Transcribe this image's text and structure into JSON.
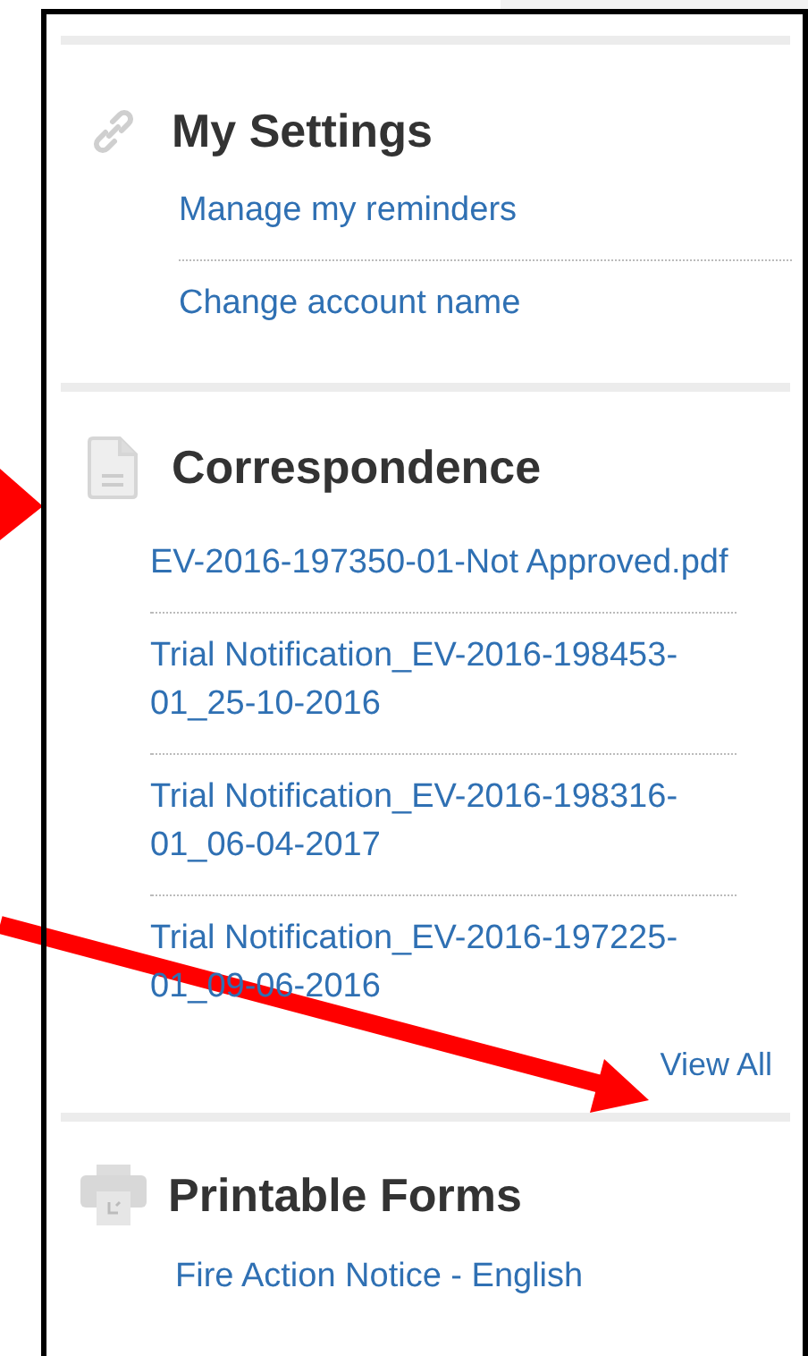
{
  "sections": [
    {
      "kind": "settings",
      "title": "My Settings",
      "links": [
        "Manage my reminders",
        "Change account name"
      ]
    },
    {
      "kind": "document",
      "title": "Correspondence",
      "links": [
        "EV-2016-197350-01-Not Approved.pdf",
        "Trial Notification_EV-2016-198453-01_25-10-2016",
        "Trial Notification_EV-2016-198316-01_06-04-2017",
        "Trial Notification_EV-2016-197225-01_09-06-2016"
      ],
      "view_all": "View All"
    },
    {
      "kind": "printer",
      "title": "Printable Forms",
      "links": [
        "Fire Action Notice - English"
      ]
    }
  ]
}
